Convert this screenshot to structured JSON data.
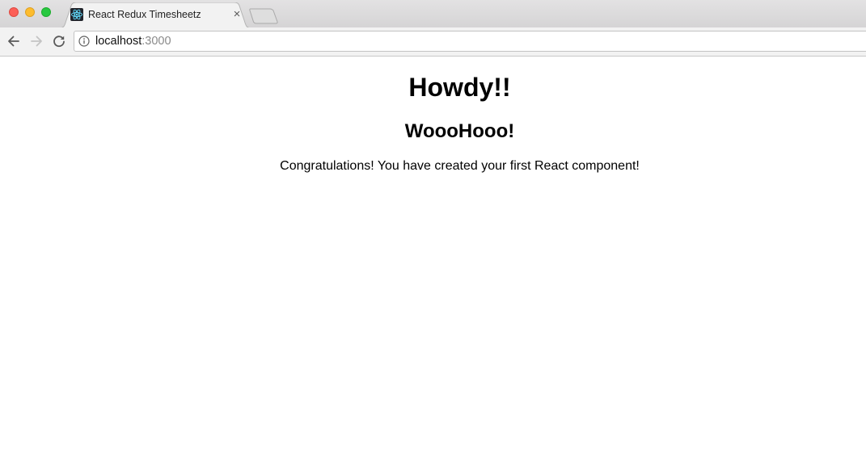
{
  "browser": {
    "tab": {
      "title": "React Redux Timesheetz",
      "favicon": "react-logo-icon",
      "close_glyph": "×"
    },
    "address_bar": {
      "host": "localhost",
      "port": ":3000"
    },
    "icons": {
      "back": "arrow-left-icon",
      "forward": "arrow-right-icon",
      "reload": "reload-icon",
      "info": "info-icon"
    }
  },
  "page": {
    "heading": "Howdy!!",
    "subheading": "WoooHooo!",
    "paragraph": "Congratulations! You have created your first React component!"
  },
  "colors": {
    "traffic_close": "#fc5f57",
    "traffic_minimize": "#fdbc2e",
    "traffic_maximize": "#28c840",
    "react_cyan": "#61dafb"
  }
}
